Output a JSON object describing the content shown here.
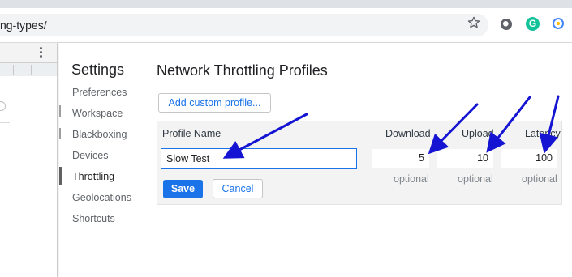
{
  "browser": {
    "url_fragment": "ng-types/",
    "star_icon": "star-icon",
    "extensions": [
      "circle-extension-icon",
      "grammarly-icon",
      "extension-icon"
    ],
    "grammarly_letter": "G"
  },
  "settings": {
    "title": "Settings",
    "nav": [
      "Preferences",
      "Workspace",
      "Blackboxing",
      "Devices",
      "Throttling",
      "Geolocations",
      "Shortcuts"
    ],
    "selected": "Throttling"
  },
  "throttling": {
    "title": "Network Throttling Profiles",
    "add_button": "Add custom profile...",
    "headers": {
      "name": "Profile Name",
      "download": "Download",
      "upload": "Upload",
      "latency": "Latency"
    },
    "profile_name_value": "Slow Test",
    "download_value": "5",
    "upload_value": "10",
    "latency_value": "100",
    "optional_label": "optional",
    "save": "Save",
    "cancel": "Cancel"
  },
  "colors": {
    "accent": "#1a73e8",
    "annotation_arrow": "#1414d2"
  }
}
